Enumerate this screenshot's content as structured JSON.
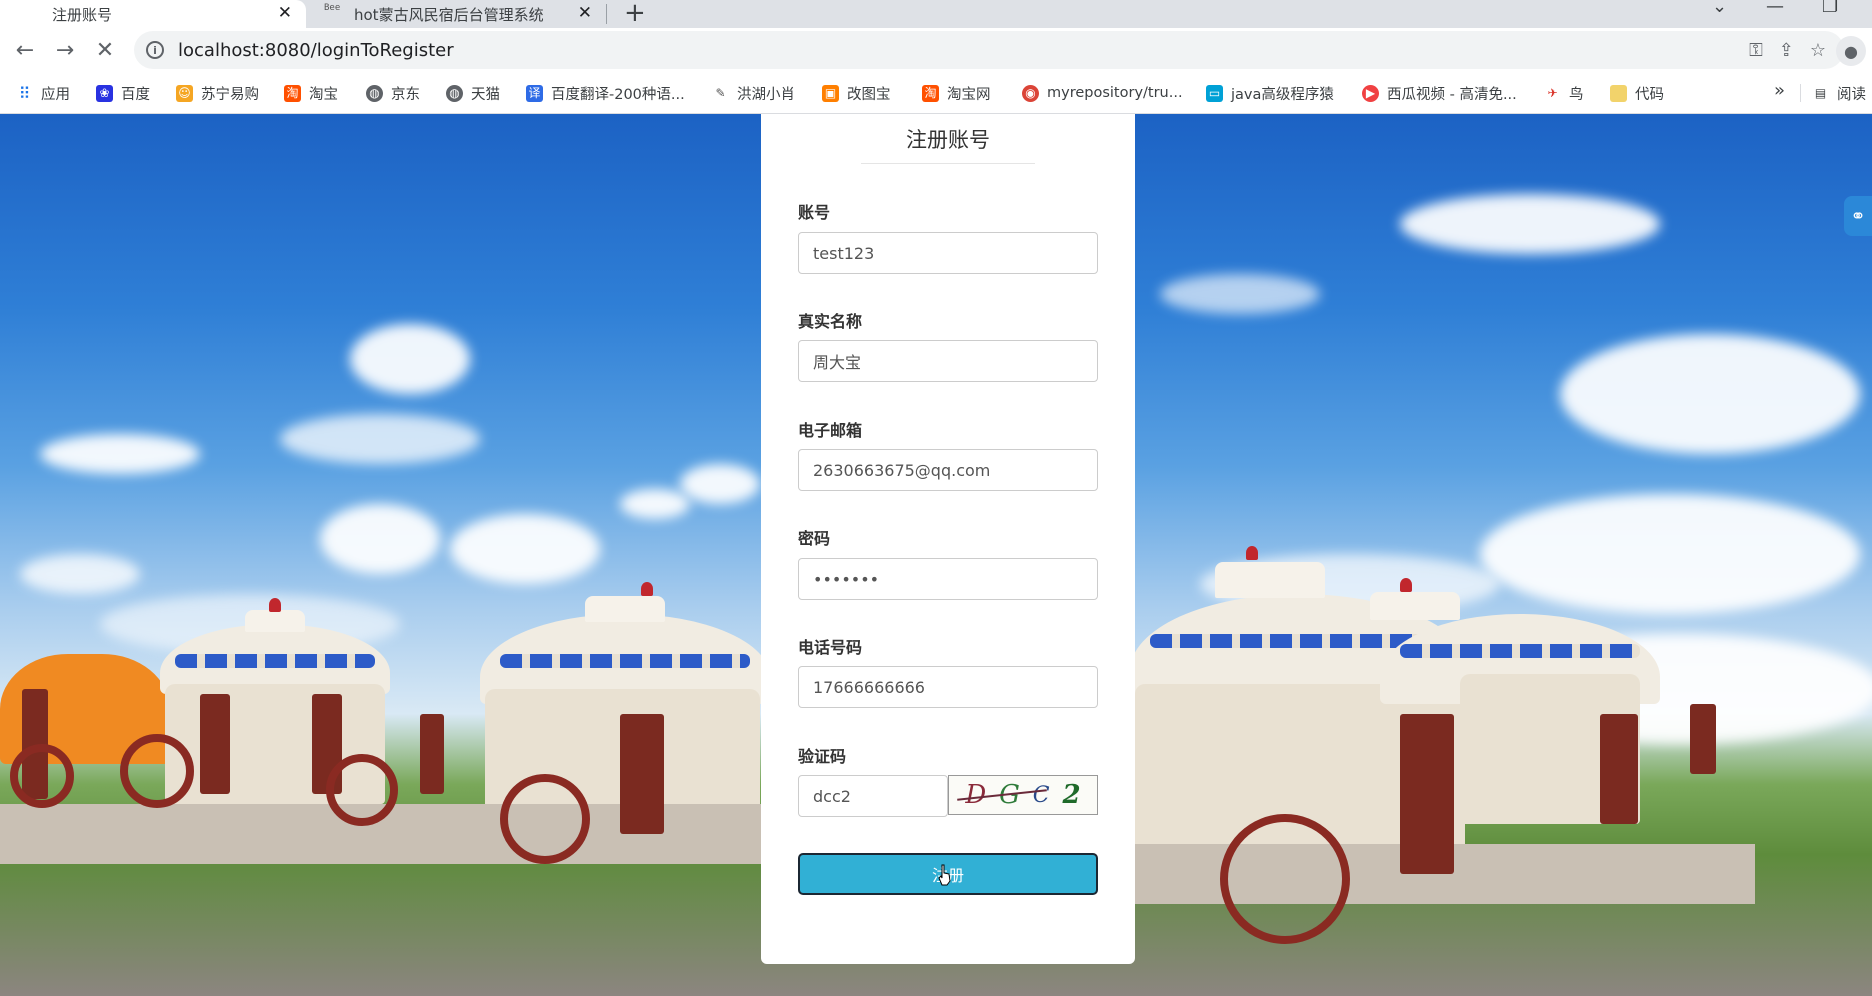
{
  "browser": {
    "tabs": [
      {
        "title": "注册账号",
        "active": true
      },
      {
        "title": "hot蒙古风民宿后台管理系统",
        "active": false,
        "favicon_text": "Bee"
      }
    ],
    "url": "localhost:8080/loginToRegister",
    "bookmarks": [
      {
        "label": "应用",
        "icon": "apps-grid-icon",
        "color": "#1a73e8"
      },
      {
        "label": "百度",
        "icon": "baidu-paw-icon",
        "color": "#2932e1"
      },
      {
        "label": "苏宁易购",
        "icon": "suning-icon",
        "color": "#f5a623"
      },
      {
        "label": "淘宝",
        "icon": "taobao-icon",
        "color": "#ff5000"
      },
      {
        "label": "京东",
        "icon": "globe-icon",
        "color": "#5f6368"
      },
      {
        "label": "天猫",
        "icon": "globe-icon",
        "color": "#5f6368"
      },
      {
        "label": "百度翻译-200种语...",
        "icon": "translate-icon",
        "color": "#2e6be6"
      },
      {
        "label": "洪湖小肖",
        "icon": "feather-icon",
        "color": "#555555"
      },
      {
        "label": "改图宝",
        "icon": "gaitubao-icon",
        "color": "#ff7f00"
      },
      {
        "label": "淘宝网",
        "icon": "taobao-icon",
        "color": "#ff5000"
      },
      {
        "label": "myrepository/tru...",
        "icon": "chrome-icon",
        "color": "#db4437"
      },
      {
        "label": "java高级程序猿",
        "icon": "bilibili-icon",
        "color": "#00a1d6"
      },
      {
        "label": "西瓜视频 - 高清免...",
        "icon": "xigua-icon",
        "color": "#f04142"
      },
      {
        "label": "鸟",
        "icon": "bird-icon",
        "color": "#d93025"
      },
      {
        "label": "代码",
        "icon": "folder-icon",
        "color": "#f2d36b"
      }
    ],
    "reading_list": "阅读"
  },
  "register": {
    "title": "注册账号",
    "fields": [
      {
        "label": "账号",
        "value": "test123"
      },
      {
        "label": "真实名称",
        "value": "周大宝"
      },
      {
        "label": "电子邮箱",
        "value": "2630663675@qq.com"
      },
      {
        "label": "密码",
        "value": "•••••••"
      },
      {
        "label": "电话号码",
        "value": "17666666666"
      }
    ],
    "captcha": {
      "label": "验证码",
      "value": "dcc2",
      "image_chars": [
        "D",
        "G",
        "C",
        "2"
      ]
    },
    "submit_label": "注册",
    "accent": "#31b0d5"
  }
}
